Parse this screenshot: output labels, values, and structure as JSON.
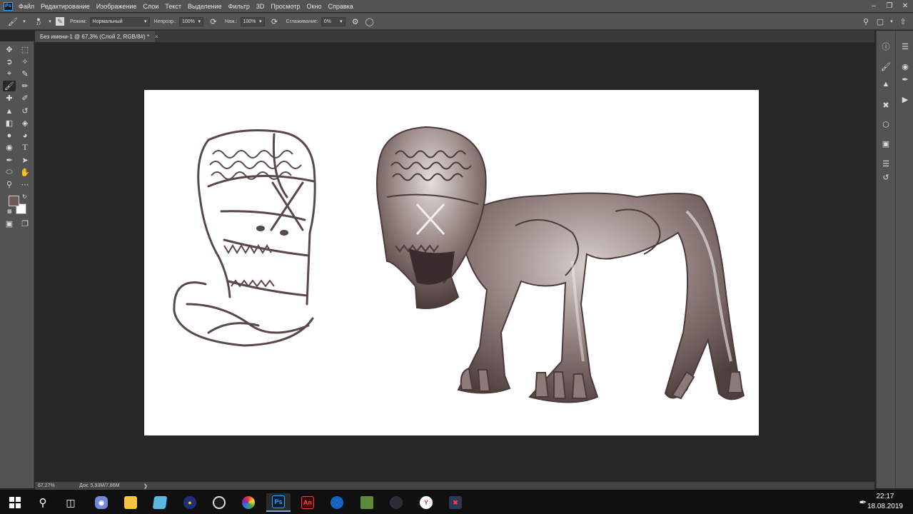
{
  "app": {
    "logo": "Ps"
  },
  "menu": [
    "Файл",
    "Редактирование",
    "Изображение",
    "Слои",
    "Текст",
    "Выделение",
    "Фильтр",
    "3D",
    "Просмотр",
    "Окно",
    "Справка"
  ],
  "options": {
    "brush_size": "17",
    "mode_label": "Режим:",
    "mode_value": "Нормальный",
    "opacity_label": "Непрозр.:",
    "opacity_value": "100%",
    "pressure_label": "Наж.:",
    "pressure_value": "100%",
    "smoothing_label": "Сглаживание:",
    "smoothing_value": "0%"
  },
  "document": {
    "tab_title": "Без имени-1 @ 67,3% (Слой 2, RGB/8#) *",
    "close_glyph": "×"
  },
  "status": {
    "zoom": "67,27%",
    "doc_size": "Док: 5,93M/7,86M",
    "arrow": "❯"
  },
  "colors": {
    "foreground": "#6b5a58",
    "background": "#ffffff",
    "sketch_ink": "#5a4848"
  },
  "taskbar": {
    "time": "22:17",
    "date": "18.08.2019",
    "apps": [
      "start",
      "search",
      "task-view",
      "discord",
      "explorer",
      "notepad",
      "opera",
      "steam",
      "color-app",
      "photoshop",
      "animate",
      "app-blue",
      "minecraft",
      "obs",
      "yandex",
      "tool-red"
    ],
    "ps_label": "Ps",
    "an_label": "An"
  }
}
